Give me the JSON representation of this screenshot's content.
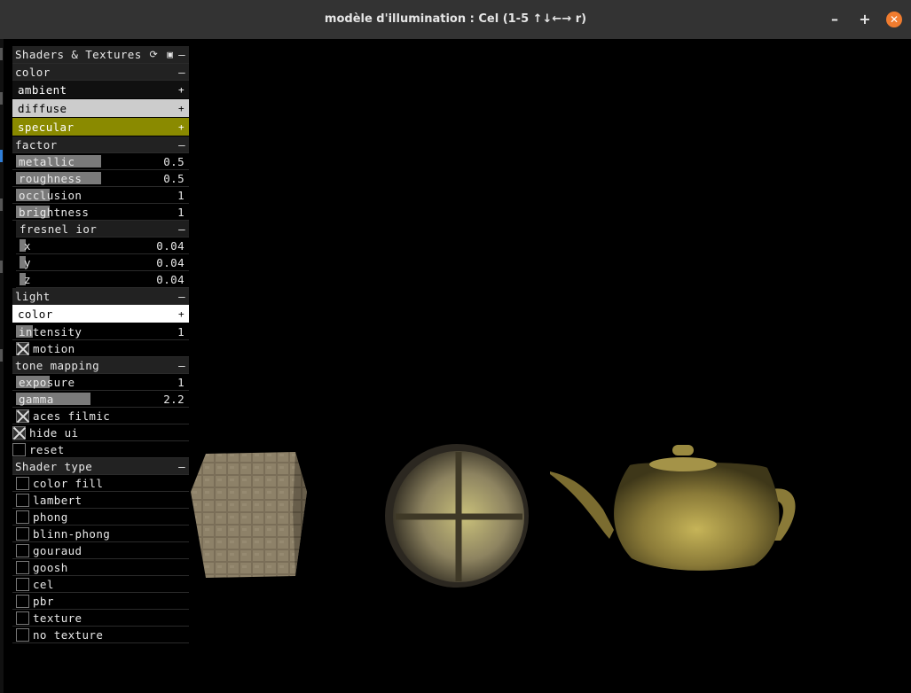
{
  "window": {
    "title": "modèle d'illumination : Cel (1-5 ↑↓←→ r)",
    "minimize": "–",
    "maximize": "+",
    "close": "✕"
  },
  "panel": {
    "title": "Shaders & Textures",
    "header_icons": "⟳ ▣",
    "collapse": "–",
    "expand": "+",
    "color": {
      "label": "color",
      "ambient": {
        "label": "ambient",
        "swatch": "#101010",
        "text_color": "#ffffff"
      },
      "diffuse": {
        "label": "diffuse",
        "swatch": "#cccccc",
        "text_color": "#000000"
      },
      "specular": {
        "label": "specular",
        "swatch": "#8a8a00",
        "text_color": "#ffffff"
      }
    },
    "factor": {
      "label": "factor",
      "metallic": {
        "label": "metallic",
        "value": "0.5",
        "level": 0.5
      },
      "roughness": {
        "label": "roughness",
        "value": "0.5",
        "level": 0.5
      },
      "occlusion": {
        "label": "occlusion",
        "value": "1",
        "level": 0.2
      },
      "brightness": {
        "label": "brightness",
        "value": "1",
        "level": 0.2
      }
    },
    "fresnel": {
      "label": "fresnel ior",
      "x": {
        "label": "x",
        "value": "0.04",
        "level": 0.04
      },
      "y": {
        "label": "y",
        "value": "0.04",
        "level": 0.04
      },
      "z": {
        "label": "z",
        "value": "0.04",
        "level": 0.04
      }
    },
    "light": {
      "label": "light",
      "color": {
        "label": "color",
        "swatch": "#ffffff",
        "text_color": "#000000"
      },
      "intensity": {
        "label": "intensity",
        "value": "1",
        "level": 0.1
      },
      "motion": {
        "label": "motion",
        "checked": true
      }
    },
    "tone": {
      "label": "tone mapping",
      "exposure": {
        "label": "exposure",
        "value": "1",
        "level": 0.2
      },
      "gamma": {
        "label": "gamma",
        "value": "2.2",
        "level": 0.44
      },
      "aces": {
        "label": "aces filmic",
        "checked": true
      }
    },
    "hide_ui": {
      "label": "hide ui",
      "checked": true
    },
    "reset": {
      "label": "reset",
      "checked": false
    },
    "shader": {
      "label": "Shader type",
      "items": [
        "color fill",
        "lambert",
        "phong",
        "blinn-phong",
        "gouraud",
        "goosh",
        "cel",
        "pbr",
        "texture",
        "no texture"
      ]
    }
  },
  "colors": {
    "titlebar": "#333333",
    "close_button": "#f07c2f",
    "slider_fill": "#7a7a7a",
    "teapot_base": "#8a7a38",
    "texture_stone": "#8a7a60"
  }
}
